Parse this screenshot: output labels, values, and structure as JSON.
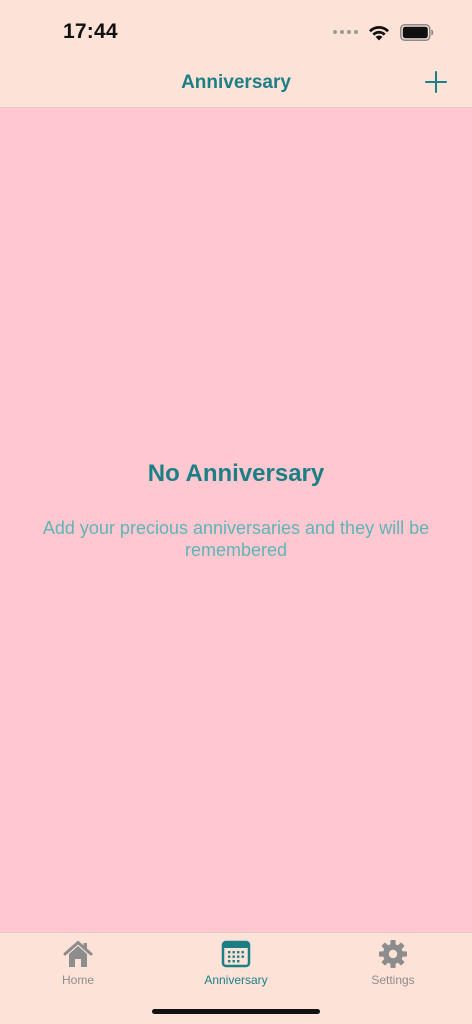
{
  "status_bar": {
    "time": "17:44"
  },
  "nav": {
    "title": "Anniversary",
    "add_icon": "plus-icon"
  },
  "empty_state": {
    "title": "No Anniversary",
    "message": "Add your precious anniversaries and they will be remembered"
  },
  "tabs": [
    {
      "label": "Home",
      "icon": "house-icon",
      "active": false
    },
    {
      "label": "Anniversary",
      "icon": "calendar-icon",
      "active": true
    },
    {
      "label": "Settings",
      "icon": "gear-icon",
      "active": false
    }
  ],
  "colors": {
    "accent": "#1c7f85",
    "accent_light": "#5fb4b7",
    "background": "#ffc8d1",
    "bars": "#fde2d8",
    "inactive": "#8d8d8d"
  }
}
